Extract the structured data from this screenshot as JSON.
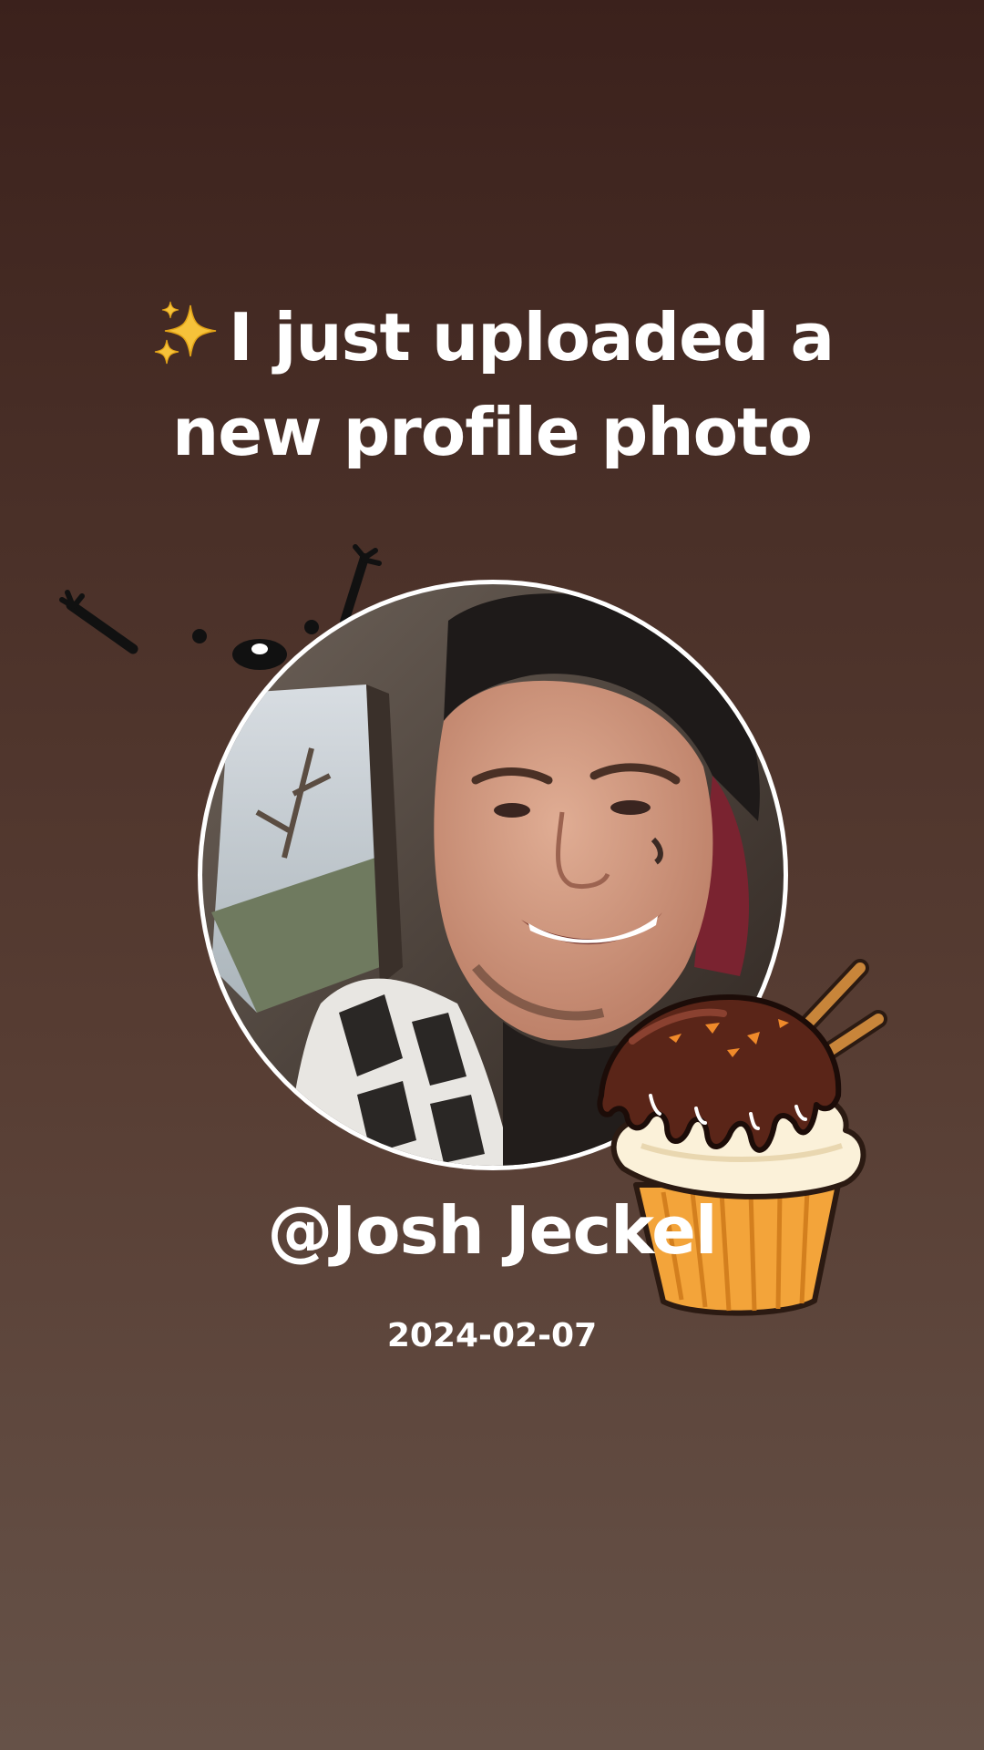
{
  "post": {
    "headline_line1": "I just uploaded a",
    "headline_line2": "new profile photo",
    "headline_icon": "sparkles-icon",
    "username": "@Josh Jeckel",
    "date": "2024-02-07"
  },
  "stickers": {
    "cupcake": "cupcake-sticker",
    "doodle": "ink-doodle-sticker"
  },
  "colors": {
    "background_top": "#3b211c",
    "background_bottom": "#665248",
    "text": "#ffffff",
    "avatar_border": "#ffffff"
  }
}
